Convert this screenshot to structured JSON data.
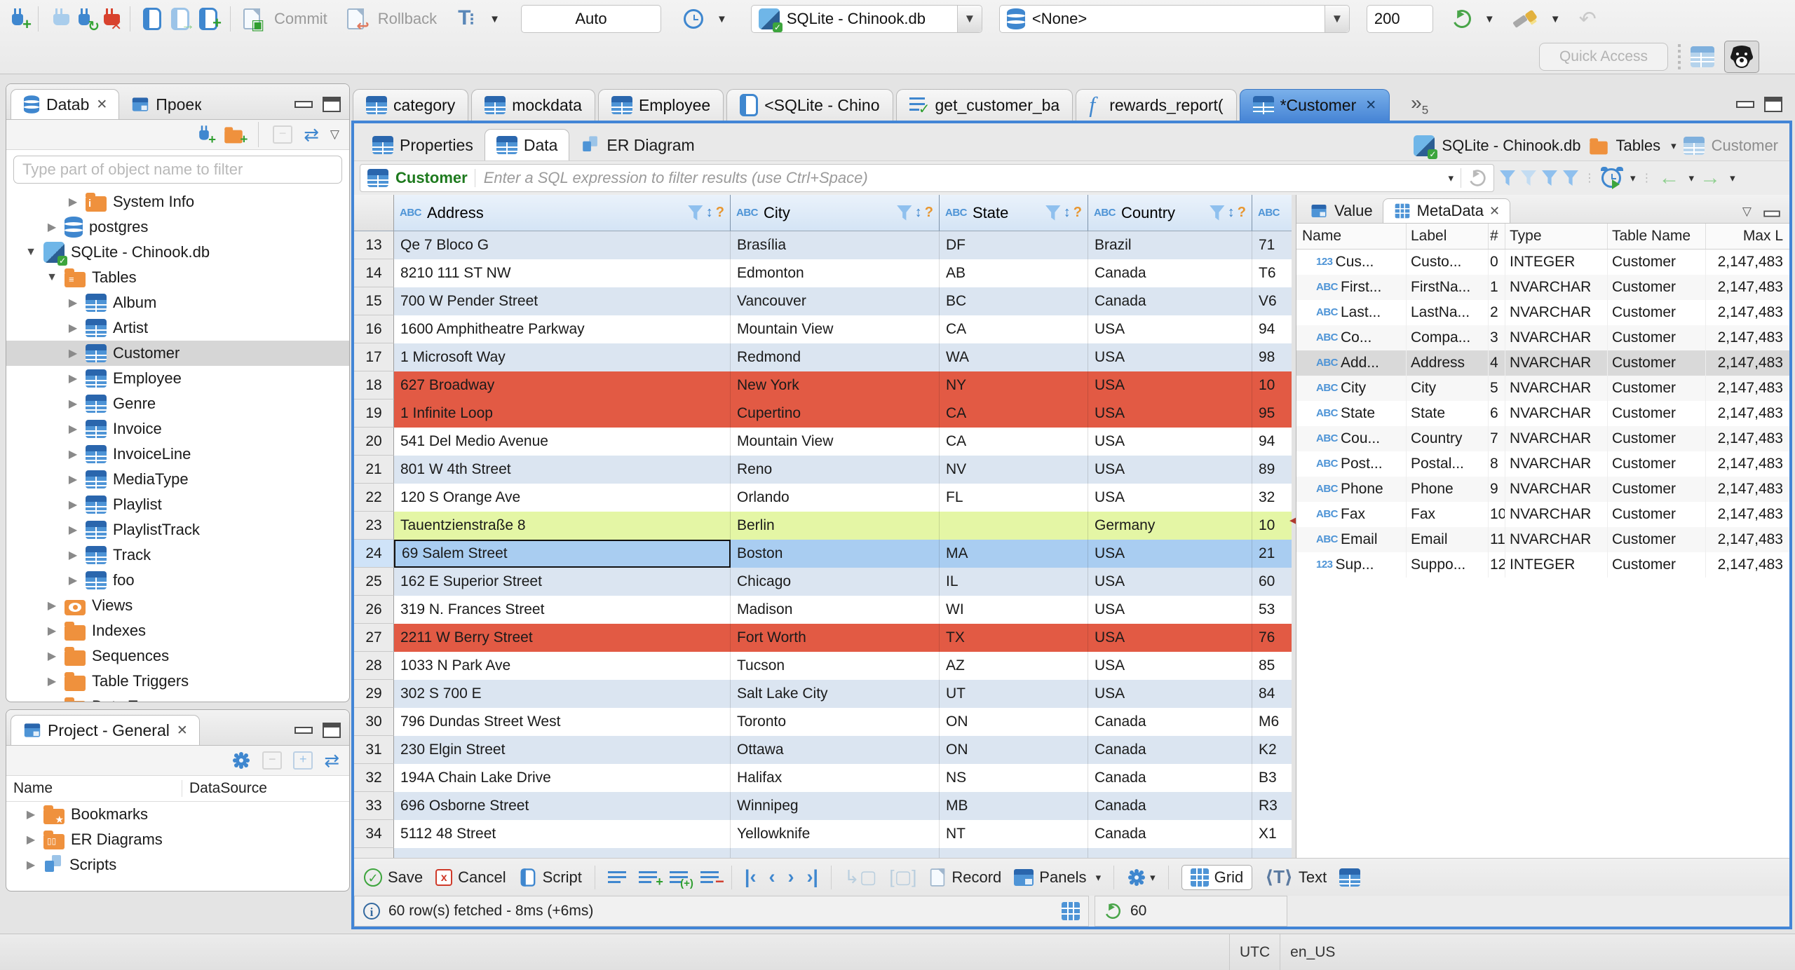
{
  "colors": {
    "accent": "#4285d6",
    "row_alt": "#dbe5f1",
    "row_plain": "#ffffff",
    "row_error": "#e25a44",
    "row_new": "#e4f6a5",
    "row_selected": "#a9cdf1",
    "selected_gutter": "#cfe3f8",
    "header_bg": "#d9e7f6",
    "tree_selection": "#d6d6d6",
    "meta_selection": "#d9d9d9"
  },
  "icons": {
    "abc": "ABC",
    "num": "123",
    "sort": "↕",
    "help": "?",
    "chevron_down": "▾",
    "tree_closed": "▶",
    "tree_open": "▼",
    "close": "✕",
    "left_arrow": "←",
    "right_arrow": "→",
    "link": "⇄",
    "menu_down": "▽",
    "more": "»"
  },
  "toolbar": {
    "commit_label": "Commit",
    "rollback_label": "Rollback",
    "txn_mode": "Auto",
    "connection_combo": "SQLite - Chinook.db",
    "schema_combo": "<None>",
    "fetch_size": "200",
    "quick_access_placeholder": "Quick Access"
  },
  "nav": {
    "tabs": [
      {
        "label": "Datab"
      },
      {
        "label": "Проек"
      }
    ],
    "filter_placeholder": "Type part of object name to filter",
    "tree": [
      {
        "label": "System Info",
        "icon": "folder-info",
        "level": 2,
        "arrow": "closed"
      },
      {
        "label": "postgres",
        "icon": "db",
        "level": 1,
        "arrow": "closed"
      },
      {
        "label": "SQLite - Chinook.db",
        "icon": "sqlite",
        "level": 0,
        "arrow": "open"
      },
      {
        "label": "Tables",
        "icon": "folder-table",
        "level": 1,
        "arrow": "open"
      },
      {
        "label": "Album",
        "icon": "table",
        "level": 2,
        "arrow": "closed"
      },
      {
        "label": "Artist",
        "icon": "table",
        "level": 2,
        "arrow": "closed"
      },
      {
        "label": "Customer",
        "icon": "table",
        "level": 2,
        "arrow": "closed",
        "selected": true
      },
      {
        "label": "Employee",
        "icon": "table",
        "level": 2,
        "arrow": "closed"
      },
      {
        "label": "Genre",
        "icon": "table",
        "level": 2,
        "arrow": "closed"
      },
      {
        "label": "Invoice",
        "icon": "table",
        "level": 2,
        "arrow": "closed"
      },
      {
        "label": "InvoiceLine",
        "icon": "table",
        "level": 2,
        "arrow": "closed"
      },
      {
        "label": "MediaType",
        "icon": "table",
        "level": 2,
        "arrow": "closed"
      },
      {
        "label": "Playlist",
        "icon": "table",
        "level": 2,
        "arrow": "closed"
      },
      {
        "label": "PlaylistTrack",
        "icon": "table",
        "level": 2,
        "arrow": "closed"
      },
      {
        "label": "Track",
        "icon": "table",
        "level": 2,
        "arrow": "closed"
      },
      {
        "label": "foo",
        "icon": "table",
        "level": 2,
        "arrow": "closed"
      },
      {
        "label": "Views",
        "icon": "views",
        "level": 1,
        "arrow": "closed"
      },
      {
        "label": "Indexes",
        "icon": "folder",
        "level": 1,
        "arrow": "closed"
      },
      {
        "label": "Sequences",
        "icon": "folder",
        "level": 1,
        "arrow": "closed"
      },
      {
        "label": "Table Triggers",
        "icon": "folder",
        "level": 1,
        "arrow": "closed"
      },
      {
        "label": "Data Types",
        "icon": "folder",
        "level": 1,
        "arrow": "closed"
      }
    ]
  },
  "project": {
    "title": "Project - General",
    "columns": [
      "Name",
      "DataSource"
    ],
    "items": [
      {
        "label": "Bookmarks",
        "icon": "folder-star"
      },
      {
        "label": "ER Diagrams",
        "icon": "folder-er"
      },
      {
        "label": "Scripts",
        "icon": "scripts"
      }
    ]
  },
  "editor_tabs": [
    {
      "label": "category",
      "icon": "table"
    },
    {
      "label": "mockdata",
      "icon": "table"
    },
    {
      "label": "Employee",
      "icon": "table"
    },
    {
      "label": "<SQLite - Chino",
      "icon": "sql"
    },
    {
      "label": "get_customer_ba",
      "icon": "script-check"
    },
    {
      "label": "rewards_report(",
      "icon": "function"
    },
    {
      "label": "*Customer",
      "icon": "table",
      "active": true,
      "closable": true
    }
  ],
  "more_tabs_count": "5",
  "result_tabs": [
    {
      "label": "Properties",
      "icon": "table"
    },
    {
      "label": "Data",
      "icon": "table",
      "active": true
    },
    {
      "label": "ER Diagram",
      "icon": "er"
    }
  ],
  "breadcrumb": {
    "connection": "SQLite - Chinook.db",
    "container": "Tables",
    "entity": "Customer"
  },
  "filter": {
    "entity": "Customer",
    "placeholder": "Enter a SQL expression to filter results (use Ctrl+Space)"
  },
  "grid": {
    "columns": [
      "Address",
      "City",
      "State",
      "Country"
    ],
    "rows": [
      {
        "n": "13",
        "a": "Qe 7 Bloco G",
        "c": "Brasília",
        "s": "DF",
        "co": "Brazil",
        "p": "71",
        "t": "alt"
      },
      {
        "n": "14",
        "a": "8210 111 ST NW",
        "c": "Edmonton",
        "s": "AB",
        "co": "Canada",
        "p": "T6",
        "t": "plain"
      },
      {
        "n": "15",
        "a": "700 W Pender Street",
        "c": "Vancouver",
        "s": "BC",
        "co": "Canada",
        "p": "V6",
        "t": "alt"
      },
      {
        "n": "16",
        "a": "1600 Amphitheatre Parkway",
        "c": "Mountain View",
        "s": "CA",
        "co": "USA",
        "p": "94",
        "t": "plain"
      },
      {
        "n": "17",
        "a": "1 Microsoft Way",
        "c": "Redmond",
        "s": "WA",
        "co": "USA",
        "p": "98",
        "t": "alt"
      },
      {
        "n": "18",
        "a": "627 Broadway",
        "c": "New York",
        "s": "NY",
        "co": "USA",
        "p": "10",
        "t": "error"
      },
      {
        "n": "19",
        "a": "1 Infinite Loop",
        "c": "Cupertino",
        "s": "CA",
        "co": "USA",
        "p": "95",
        "t": "error"
      },
      {
        "n": "20",
        "a": "541 Del Medio Avenue",
        "c": "Mountain View",
        "s": "CA",
        "co": "USA",
        "p": "94",
        "t": "plain"
      },
      {
        "n": "21",
        "a": "801 W 4th Street",
        "c": "Reno",
        "s": "NV",
        "co": "USA",
        "p": "89",
        "t": "alt"
      },
      {
        "n": "22",
        "a": "120 S Orange Ave",
        "c": "Orlando",
        "s": "FL",
        "co": "USA",
        "p": "32",
        "t": "plain"
      },
      {
        "n": "23",
        "a": "Tauentzienstraße 8",
        "c": "Berlin",
        "s": "",
        "co": "Germany",
        "p": "10",
        "t": "new"
      },
      {
        "n": "24",
        "a": "69 Salem Street",
        "c": "Boston",
        "s": "MA",
        "co": "USA",
        "p": "21",
        "t": "selected",
        "focus": true
      },
      {
        "n": "25",
        "a": "162 E Superior Street",
        "c": "Chicago",
        "s": "IL",
        "co": "USA",
        "p": "60",
        "t": "alt"
      },
      {
        "n": "26",
        "a": "319 N. Frances Street",
        "c": "Madison",
        "s": "WI",
        "co": "USA",
        "p": "53",
        "t": "plain"
      },
      {
        "n": "27",
        "a": "2211 W Berry Street",
        "c": "Fort Worth",
        "s": "TX",
        "co": "USA",
        "p": "76",
        "t": "error"
      },
      {
        "n": "28",
        "a": "1033 N Park Ave",
        "c": "Tucson",
        "s": "AZ",
        "co": "USA",
        "p": "85",
        "t": "plain"
      },
      {
        "n": "29",
        "a": "302 S 700 E",
        "c": "Salt Lake City",
        "s": "UT",
        "co": "USA",
        "p": "84",
        "t": "alt"
      },
      {
        "n": "30",
        "a": "796 Dundas Street West",
        "c": "Toronto",
        "s": "ON",
        "co": "Canada",
        "p": "M6",
        "t": "plain"
      },
      {
        "n": "31",
        "a": "230 Elgin Street",
        "c": "Ottawa",
        "s": "ON",
        "co": "Canada",
        "p": "K2",
        "t": "alt"
      },
      {
        "n": "32",
        "a": "194A Chain Lake Drive",
        "c": "Halifax",
        "s": "NS",
        "co": "Canada",
        "p": "B3",
        "t": "plain"
      },
      {
        "n": "33",
        "a": "696 Osborne Street",
        "c": "Winnipeg",
        "s": "MB",
        "co": "Canada",
        "p": "R3",
        "t": "alt"
      },
      {
        "n": "34",
        "a": "5112 48 Street",
        "c": "Yellowknife",
        "s": "NT",
        "co": "Canada",
        "p": "X1",
        "t": "plain"
      },
      {
        "n": "",
        "a": "",
        "c": "",
        "s": "",
        "co": "",
        "p": "",
        "t": "alt"
      }
    ]
  },
  "meta": {
    "tabs": [
      "Value",
      "MetaData"
    ],
    "columns": [
      "Name",
      "Label",
      "#",
      "Type",
      "Table Name",
      "Max L"
    ],
    "rows": [
      {
        "i": "123",
        "name": "Cus...",
        "label": "Custo...",
        "n": "0",
        "type": "INTEGER",
        "table": "Customer",
        "max": "2,147,483"
      },
      {
        "i": "ABC",
        "name": "First...",
        "label": "FirstNa...",
        "n": "1",
        "type": "NVARCHAR",
        "table": "Customer",
        "max": "2,147,483"
      },
      {
        "i": "ABC",
        "name": "Last...",
        "label": "LastNa...",
        "n": "2",
        "type": "NVARCHAR",
        "table": "Customer",
        "max": "2,147,483"
      },
      {
        "i": "ABC",
        "name": "Co...",
        "label": "Compa...",
        "n": "3",
        "type": "NVARCHAR",
        "table": "Customer",
        "max": "2,147,483"
      },
      {
        "i": "ABC",
        "name": "Add...",
        "label": "Address",
        "n": "4",
        "type": "NVARCHAR",
        "table": "Customer",
        "max": "2,147,483",
        "selected": true
      },
      {
        "i": "ABC",
        "name": "City",
        "label": "City",
        "n": "5",
        "type": "NVARCHAR",
        "table": "Customer",
        "max": "2,147,483"
      },
      {
        "i": "ABC",
        "name": "State",
        "label": "State",
        "n": "6",
        "type": "NVARCHAR",
        "table": "Customer",
        "max": "2,147,483"
      },
      {
        "i": "ABC",
        "name": "Cou...",
        "label": "Country",
        "n": "7",
        "type": "NVARCHAR",
        "table": "Customer",
        "max": "2,147,483"
      },
      {
        "i": "ABC",
        "name": "Post...",
        "label": "Postal...",
        "n": "8",
        "type": "NVARCHAR",
        "table": "Customer",
        "max": "2,147,483"
      },
      {
        "i": "ABC",
        "name": "Phone",
        "label": "Phone",
        "n": "9",
        "type": "NVARCHAR",
        "table": "Customer",
        "max": "2,147,483"
      },
      {
        "i": "ABC",
        "name": "Fax",
        "label": "Fax",
        "n": "10",
        "type": "NVARCHAR",
        "table": "Customer",
        "max": "2,147,483"
      },
      {
        "i": "ABC",
        "name": "Email",
        "label": "Email",
        "n": "11",
        "type": "NVARCHAR",
        "table": "Customer",
        "max": "2,147,483"
      },
      {
        "i": "123",
        "name": "Sup...",
        "label": "Suppo...",
        "n": "12",
        "type": "INTEGER",
        "table": "Customer",
        "max": "2,147,483"
      }
    ]
  },
  "bottom_toolbar": {
    "save": "Save",
    "cancel": "Cancel",
    "script": "Script",
    "record": "Record",
    "panels": "Panels",
    "grid": "Grid",
    "text": "Text"
  },
  "status": {
    "info": "60 row(s) fetched - 8ms (+6ms)",
    "refresh_value": "60"
  },
  "statusbar": {
    "timezone": "UTC",
    "locale": "en_US"
  }
}
